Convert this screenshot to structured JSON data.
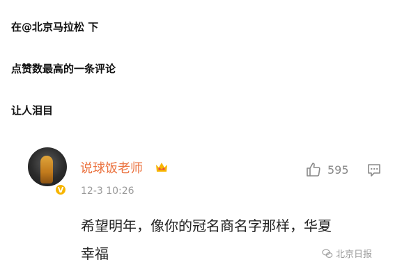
{
  "post": {
    "line1": "在@北京马拉松 下",
    "line2": "点赞数最高的一条评论",
    "line3": "让人泪目"
  },
  "comment": {
    "username": "说球饭老师",
    "timestamp": "12-3 10:26",
    "likes": "595",
    "text": "希望明年，像你的冠名商名字那样，华夏幸福",
    "username_color": "#eb7340",
    "icons": [
      "avatar",
      "verified-badge",
      "crown-icon",
      "thumbs-up-icon",
      "comment-icon"
    ]
  },
  "watermark": {
    "label": "北京日报",
    "icon": "wechat-icon"
  }
}
